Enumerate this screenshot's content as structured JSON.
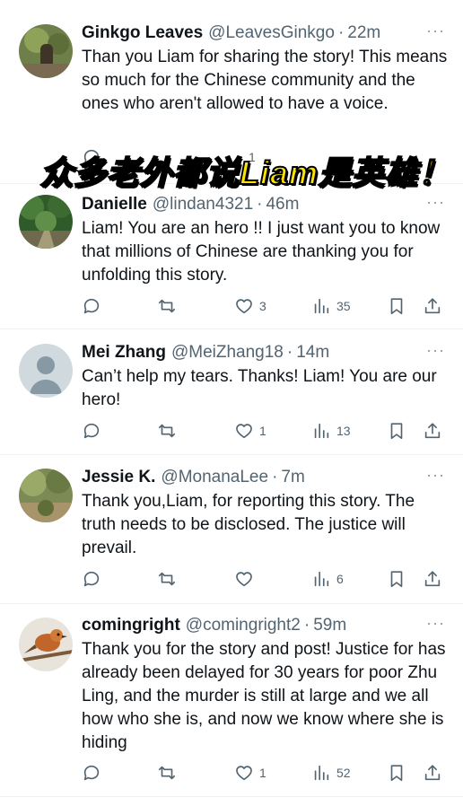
{
  "overlay_caption": "众多老外都说Liam是英雄！",
  "tweets": [
    {
      "name": "Ginkgo Leaves",
      "handle": "@LeavesGinkgo",
      "time": "22m",
      "text": "Than you Liam for sharing the story! This means so much for the Chinese community and the ones who aren't allowed to have a voice.",
      "replies": "",
      "likes": "1",
      "views": "",
      "avatar": "ginkgo-photo"
    },
    {
      "name": "Danielle",
      "handle": "@lindan4321",
      "time": "46m",
      "text": "Liam! You are an hero !! I just want you to know that millions of Chinese are thanking you for unfolding this story.",
      "likes": "3",
      "views": "35",
      "avatar": "forest-photo"
    },
    {
      "name": "Mei Zhang",
      "handle": "@MeiZhang18",
      "time": "14m",
      "text": "Can’t help my tears. Thanks! Liam! You are our hero!",
      "likes": "1",
      "views": "13",
      "avatar": "default-profile"
    },
    {
      "name": "Jessie K.",
      "handle": "@MonanaLee",
      "time": "7m",
      "text": "Thank you,Liam, for reporting this story. The truth needs to be disclosed. The justice will prevail.",
      "likes": "",
      "views": "6",
      "avatar": "garden-photo"
    },
    {
      "name": "comingright",
      "handle": "@comingright2",
      "time": "59m",
      "text": "Thank you for the story and post! Justice for has already been delayed for 30 years for poor Zhu Ling, and the murder is still at large and we all how who she is, and now we know where she is hiding",
      "likes": "1",
      "views": "52",
      "avatar": "bird-photo"
    }
  ],
  "more_glyph": "···",
  "colors": {
    "text": "#0f1419",
    "secondary": "#536471",
    "divider": "#eff3f4",
    "caption": "#fde400"
  }
}
